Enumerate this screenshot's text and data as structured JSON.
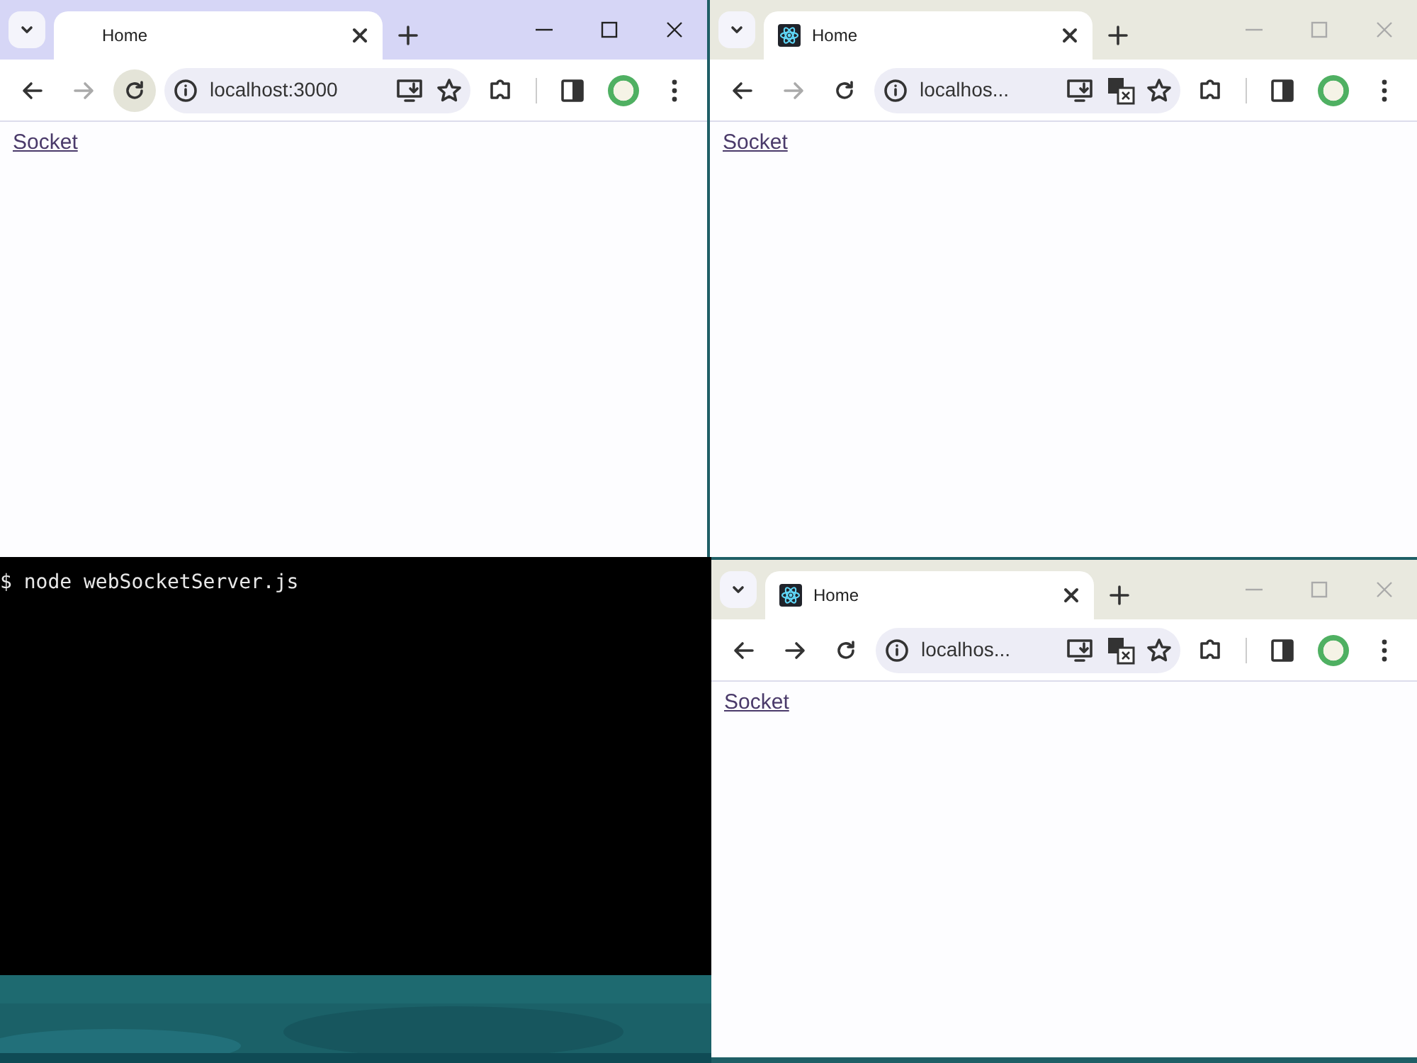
{
  "browser_windows": [
    {
      "focused": true,
      "tab": {
        "title": "Home",
        "favicon": false
      },
      "forward_disabled": true,
      "reload_hover": true,
      "url": "localhost:3000",
      "translate": false,
      "page_link": "Socket"
    },
    {
      "focused": false,
      "tab": {
        "title": "Home",
        "favicon": true
      },
      "forward_disabled": true,
      "reload_hover": false,
      "url": "localhos...",
      "translate": true,
      "page_link": "Socket"
    },
    {
      "focused": false,
      "tab": {
        "title": "Home",
        "favicon": true
      },
      "forward_disabled": false,
      "reload_hover": false,
      "url": "localhos...",
      "translate": true,
      "page_link": "Socket"
    }
  ],
  "terminal": {
    "command": "$ node webSocketServer.js"
  }
}
